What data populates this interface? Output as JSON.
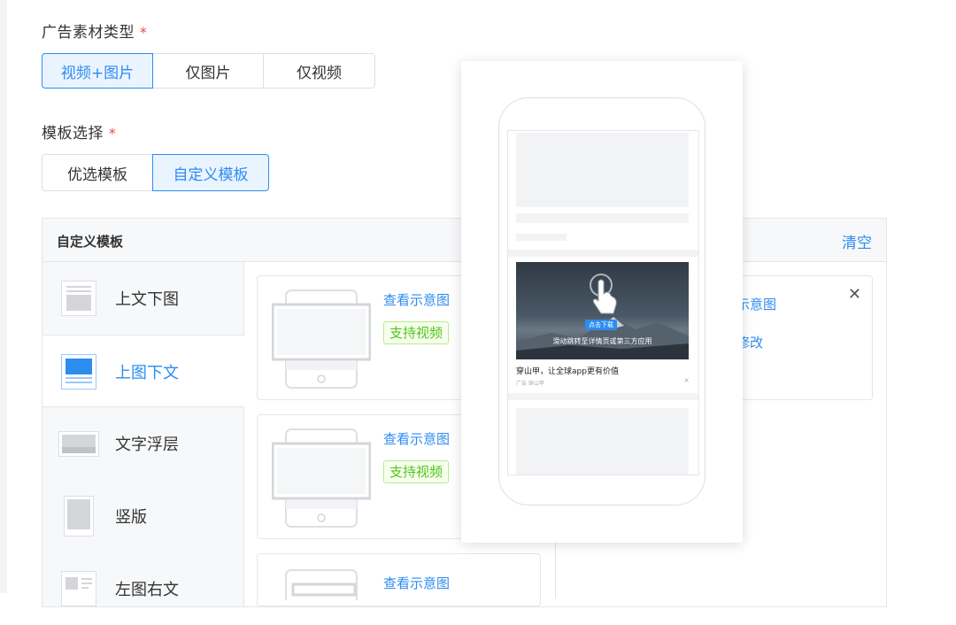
{
  "form": {
    "material_type_label": "广告素材类型",
    "required_mark": "*",
    "material_options": [
      "视频+图片",
      "仅图片",
      "仅视频"
    ],
    "material_selected": "视频+图片",
    "template_label": "模板选择",
    "template_options": [
      "优选模板",
      "自定义模板"
    ],
    "template_selected": "自定义模板"
  },
  "panel": {
    "title": "自定义模板",
    "clear_label": "清空",
    "sidebar": [
      {
        "label": "上文下图",
        "icon": "text-top-image-bottom-icon"
      },
      {
        "label": "上图下文",
        "icon": "image-top-text-bottom-icon"
      },
      {
        "label": "文字浮层",
        "icon": "text-overlay-icon"
      },
      {
        "label": "竖版",
        "icon": "vertical-icon"
      },
      {
        "label": "左图右文",
        "icon": "image-left-text-right-icon"
      }
    ],
    "sidebar_selected": "上图下文",
    "cards": [
      {
        "link": "查看示意图",
        "tag": "支持视频"
      },
      {
        "link": "查看示意图",
        "tag": "支持视频"
      },
      {
        "link": "查看示意图"
      }
    ],
    "selected_card": {
      "link": "示意图",
      "edit": "修改",
      "close_icon": "close-icon"
    }
  },
  "preview": {
    "ad_button": "点击下载",
    "ad_caption": "滑动跳转至详情页或第三方应用",
    "ad_title": "穿山甲，让全球app更有价值",
    "ad_meta": "广告 穿山甲",
    "ad_close": "×"
  },
  "colors": {
    "accent": "#2d8cf0",
    "required": "#e84b4b",
    "tag_green": "#52c41a"
  }
}
